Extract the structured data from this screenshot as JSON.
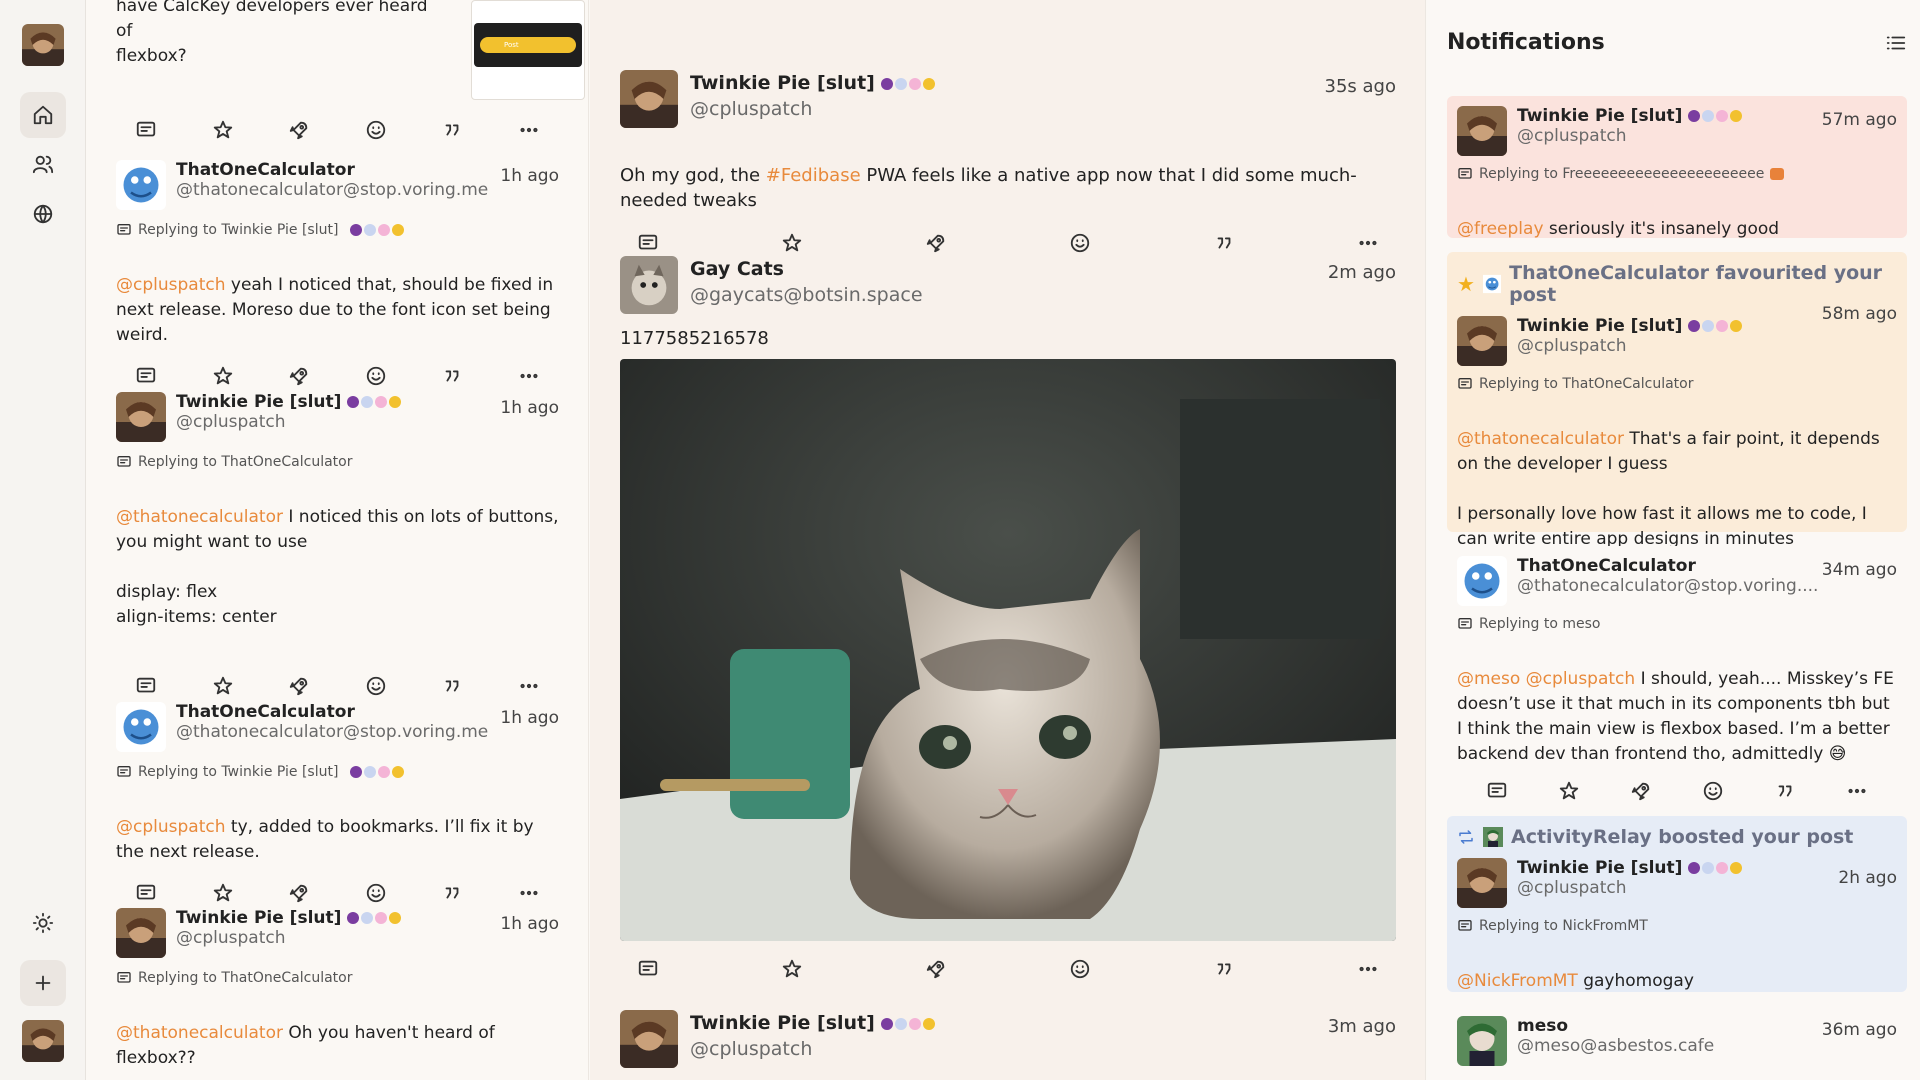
{
  "rail": {
    "items": [
      "home",
      "users",
      "globe"
    ]
  },
  "left_column": {
    "partial_post": {
      "text": "have CalcKey developers ever heard of\nflexbox?",
      "preview_label": "Post"
    },
    "notes": [
      {
        "name": "ThatOneCalculator",
        "handle": "@thatonecalculator@stop.voring.me",
        "time": "1h ago",
        "reply_to": "Replying to Twinkie Pie [slut]",
        "mention": "@cpluspatch",
        "text": " yeah I noticed that, should be fixed in next release. Moreso due to the font icon set being weird."
      },
      {
        "name": "Twinkie Pie [slut]",
        "handle": "@cpluspatch",
        "time": "1h ago",
        "reply_to": "Replying to ThatOneCalculator",
        "mention": "@thatonecalculator",
        "text": " I noticed this on lots of buttons, you might want to use\n\ndisplay: flex\nalign-items: center"
      },
      {
        "name": "ThatOneCalculator",
        "handle": "@thatonecalculator@stop.voring.me",
        "time": "1h ago",
        "reply_to": "Replying to Twinkie Pie [slut]",
        "mention": "@cpluspatch",
        "text": " ty, added to bookmarks. I’ll fix it by the next release."
      },
      {
        "name": "Twinkie Pie [slut]",
        "handle": "@cpluspatch",
        "time": "1h ago",
        "reply_to": "Replying to ThatOneCalculator",
        "mention": "@thatonecalculator",
        "text": " Oh you haven't heard of flexbox??"
      }
    ]
  },
  "center_column": {
    "notes": [
      {
        "name": "Twinkie Pie [slut]",
        "handle": "@cpluspatch",
        "time": "35s ago",
        "text_before": "Oh my god, the ",
        "hashtag": "#Fedibase",
        "text_after": " PWA feels like a native app now that I did some much-needed tweaks"
      },
      {
        "name": "Gay Cats",
        "handle": "@gaycats@botsin.space",
        "time": "2m ago",
        "text": "1177585216578",
        "image_label": "kitten photo"
      },
      {
        "name": "Twinkie Pie [slut]",
        "handle": "@cpluspatch",
        "time": "3m ago"
      }
    ]
  },
  "notifications": {
    "title": "Notifications",
    "cards": [
      {
        "name": "Twinkie Pie [slut]",
        "handle": "@cpluspatch",
        "time": "57m ago",
        "reply_to": "Replying to Freeeeeeeeeeeeeeeeeeeeee",
        "mention": "@freeplay",
        "text": " seriously it's insanely good"
      },
      {
        "label": "ThatOneCalculator favourited your post",
        "name": "Twinkie Pie [slut]",
        "handle": "@cpluspatch",
        "time": "58m ago",
        "reply_to": "Replying to ThatOneCalculator",
        "mention": "@thatonecalculator",
        "text": " That's a fair point, it depends on the developer I guess\n\nI personally love how fast it allows me to code, I can write entire app designs in minutes"
      },
      {
        "name": "ThatOneCalculator",
        "handle": "@thatonecalculator@stop.voring....",
        "time": "34m ago",
        "reply_to": "Replying to meso",
        "mention": "@meso @cpluspatch",
        "text": " I should, yeah.... Misskey’s FE doesn’t use it that much in its components tbh but I think the main view is flexbox based. I’m a better backend dev than frontend tho, admittedly 😅"
      },
      {
        "label": "ActivityRelay boosted your post",
        "name": "Twinkie Pie [slut]",
        "handle": "@cpluspatch",
        "time": "2h ago",
        "reply_to": "Replying to NickFromMT",
        "mention": "@NickFromMT",
        "text": " gayhomogay"
      },
      {
        "name": "meso",
        "handle": "@meso@asbestos.cafe",
        "time": "36m ago"
      }
    ]
  },
  "colors": {
    "accent": "#e88a3c",
    "favourite_bg": "#fbecd9",
    "reply_bg": "#fbe3dd",
    "boost_bg": "#e6ecf6"
  }
}
